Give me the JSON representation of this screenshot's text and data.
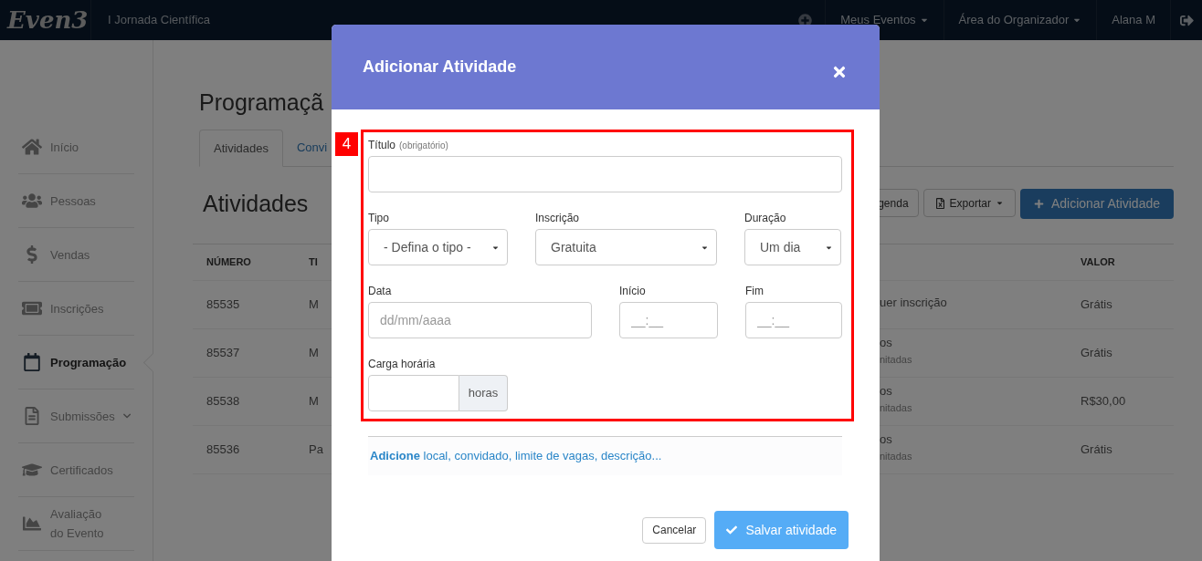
{
  "top_bar": {
    "logo": "Even3",
    "event_name": "I Jornada Científica",
    "menus": [
      {
        "label": "Meus Eventos",
        "dropdown": true
      },
      {
        "label": "Área do Organizador",
        "dropdown": true
      },
      {
        "label": "Alana M",
        "dropdown": false
      }
    ]
  },
  "sidebar": {
    "items": [
      {
        "label": "Início",
        "selected": false,
        "expandable": false
      },
      {
        "label": "Pessoas",
        "selected": false,
        "expandable": false
      },
      {
        "label": "Vendas",
        "selected": false,
        "expandable": false
      },
      {
        "label": "Inscrições",
        "selected": false,
        "expandable": false
      },
      {
        "label": "Programação",
        "selected": true,
        "expandable": false
      },
      {
        "label": "Submissões",
        "selected": false,
        "expandable": true
      },
      {
        "label": "Certificados",
        "selected": false,
        "expandable": false
      },
      {
        "label": "Avaliação\ndo Evento",
        "selected": false,
        "expandable": false
      }
    ]
  },
  "main": {
    "page_title": "Programaçã",
    "tabs": [
      {
        "label": "Atividades",
        "selected": true
      },
      {
        "label": "Convi",
        "selected": false
      }
    ],
    "section_title": "Atividades",
    "toolbar": [
      {
        "label": "genda",
        "kind": "plain"
      },
      {
        "label": "Exportar",
        "kind": "export"
      },
      {
        "label": "Adicionar Atividade",
        "kind": "primary"
      }
    ],
    "table": {
      "columns": [
        "NÚMERO",
        "TI",
        "VALOR"
      ],
      "rows": [
        {
          "number": "85535",
          "column_2": "M",
          "column_3": "uer inscrição",
          "valor": "Grátis"
        },
        {
          "number": "85537",
          "column_2": "M",
          "column_3": "os",
          "column_3_note": "nitadas",
          "valor": "Grátis"
        },
        {
          "number": "85538",
          "column_2": "M",
          "column_3": "os",
          "column_3_note": "nitadas",
          "valor": "R$30,00"
        },
        {
          "number": "85536",
          "column_2": "Pa",
          "column_3": "os",
          "column_3_note": "nitadas",
          "valor": "Grátis"
        }
      ]
    }
  },
  "modal": {
    "title": "Adicionar Atividade",
    "annotation": "4",
    "rows": [
      [
        {
          "label": "Título",
          "hint": "(obrigatório)",
          "kind": "text"
        }
      ],
      [
        {
          "label": "Tipo",
          "kind": "select",
          "value": "- Defina o tipo -"
        },
        {
          "label": "Inscrição",
          "kind": "select",
          "value": "Gratuita"
        },
        {
          "label": "Duração",
          "kind": "select",
          "value": "Um dia"
        }
      ],
      [
        {
          "label": "Data",
          "kind": "text",
          "placeholder": "dd/mm/aaaa"
        },
        {
          "label": "Início",
          "kind": "text",
          "placeholder": "__:__"
        },
        {
          "label": "Fim",
          "kind": "text",
          "placeholder": "__:__"
        }
      ],
      [
        {
          "label": "Carga horária",
          "kind": "addon",
          "addon": "horas"
        }
      ]
    ],
    "more_link": "**Adicione** local, convidado, limite de vagas, descrição...",
    "buttons": [
      {
        "label": "Cancelar",
        "kind": "secondary"
      },
      {
        "label": "Salvar atividade",
        "kind": "primary"
      }
    ]
  }
}
